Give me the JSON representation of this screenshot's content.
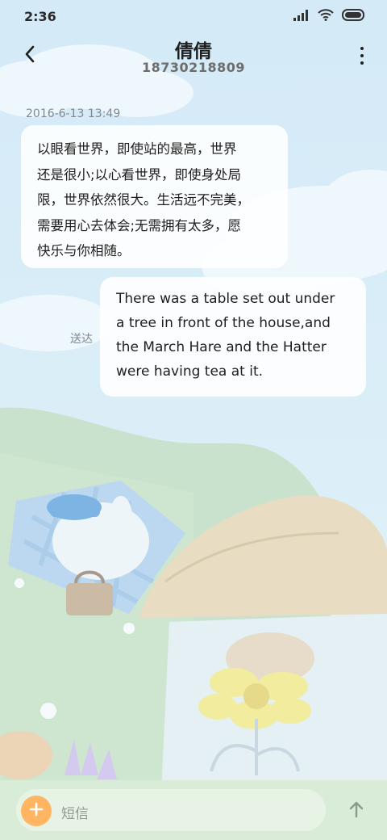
{
  "status_bar": {
    "time": "2:36"
  },
  "header": {
    "contact_name": "倩倩",
    "phone_number": "18730218809"
  },
  "thread": {
    "timestamp": "2016-6-13 13:49",
    "incoming_lines": [
      "以眼看世界，即使站的最高，世界",
      "还是很小;以心看世界，即使身处局",
      "限，世界依然很大。生活远不完美，",
      "需要用心去体会;无需拥有太多，愿",
      "快乐与你相随。"
    ],
    "outgoing_lines": [
      "There was a table set out under",
      "a tree in front of the house,and",
      "the March Hare and the Hatter",
      "were having tea at it."
    ],
    "delivery_status": "送达"
  },
  "composer": {
    "placeholder": "短信"
  },
  "icons": {
    "signal": "signal-icon",
    "wifi": "wifi-icon",
    "battery": "battery-icon",
    "back": "back-arrow-icon",
    "more": "more-vertical-icon",
    "plus": "plus-icon",
    "send": "send-arrow-icon"
  },
  "colors": {
    "accent": "#ffb561",
    "bubble": "#ffffff",
    "background": "#d6ebf6"
  }
}
